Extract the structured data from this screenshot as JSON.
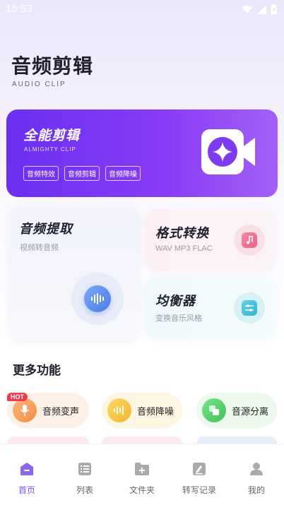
{
  "status_bar": {
    "time": "16:53"
  },
  "header": {
    "title": "音频剪辑",
    "subtitle": "AUDIO CLIP"
  },
  "hero": {
    "title": "全能剪辑",
    "subtitle": "ALMIGHTY CLIP",
    "tags": [
      "音频特效",
      "音频剪辑",
      "音频降噪"
    ],
    "icon": "video-edit-icon"
  },
  "cards": {
    "extract": {
      "title": "音频提取",
      "desc": "视频转音频",
      "icon": "waveform-icon"
    },
    "format": {
      "title": "格式转换",
      "desc": "WAV  MP3  FLAC",
      "icon": "music-note-icon"
    },
    "equalizer": {
      "title": "均衡器",
      "desc": "变换音乐风格",
      "icon": "sliders-icon"
    }
  },
  "more": {
    "title": "更多功能",
    "hot_badge": "HOT",
    "items": [
      {
        "label": "音频变声",
        "icon": "microphone-icon",
        "color": "#f7a35c"
      },
      {
        "label": "音频降噪",
        "icon": "waveform-icon",
        "color": "#f5c443"
      },
      {
        "label": "音源分离",
        "icon": "layers-icon",
        "color": "#5dd36f"
      }
    ]
  },
  "tabbar": {
    "active": 0,
    "items": [
      {
        "label": "首页",
        "icon": "home-icon"
      },
      {
        "label": "列表",
        "icon": "list-icon"
      },
      {
        "label": "文件夹",
        "icon": "folder-add-icon"
      },
      {
        "label": "转写记录",
        "icon": "edit-document-icon"
      },
      {
        "label": "我的",
        "icon": "user-icon"
      }
    ]
  },
  "colors": {
    "accent": "#7b4ff0",
    "hero_start": "#6a2ff2",
    "hero_end": "#a460f7",
    "hot": "#ee3b4b"
  }
}
